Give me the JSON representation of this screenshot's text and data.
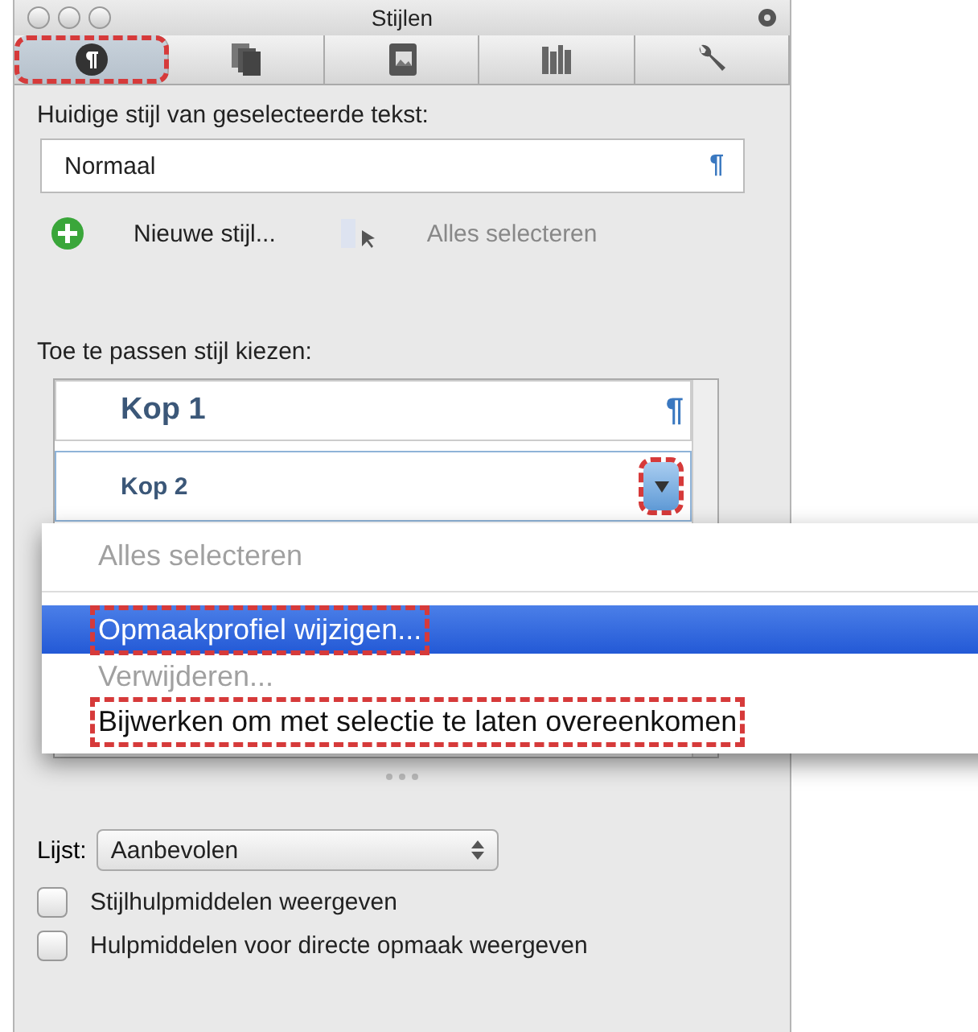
{
  "window": {
    "title": "Stijlen"
  },
  "tabs": [
    {
      "selected": true,
      "annotated": true
    },
    {
      "selected": false,
      "annotated": false
    },
    {
      "selected": false,
      "annotated": false
    },
    {
      "selected": false,
      "annotated": false
    },
    {
      "selected": false,
      "annotated": false
    }
  ],
  "current_style": {
    "label": "Huidige stijl van geselecteerde tekst:",
    "value": "Normaal",
    "mark": "¶"
  },
  "actions": [
    {
      "kind": "new",
      "label": "Nieuwe stijl...",
      "disabled": false
    },
    {
      "kind": "select_all",
      "label": "Alles selecteren",
      "disabled": true
    }
  ],
  "style_list": {
    "label": "Toe te passen stijl kiezen:",
    "items": [
      {
        "name": "Kop 1",
        "kind": "large",
        "mark": "¶",
        "expanded": false
      },
      {
        "name": "Kop 2",
        "kind": "small",
        "expanded": true,
        "annotated": true
      }
    ]
  },
  "context_menu": {
    "items": [
      {
        "label": "Alles selecteren",
        "disabled": true,
        "selected": false,
        "annotated": false
      },
      {
        "kind": "separator"
      },
      {
        "label": "Opmaakprofiel wijzigen...",
        "disabled": false,
        "selected": true,
        "annotated": true
      },
      {
        "label": "Verwijderen...",
        "disabled": true,
        "selected": false,
        "annotated": false
      },
      {
        "label": "Bijwerken om met selectie te laten overeenkomen",
        "disabled": false,
        "selected": false,
        "annotated": true
      }
    ]
  },
  "list_filter": {
    "label": "Lijst:",
    "value": "Aanbevolen"
  },
  "options": [
    {
      "label": "Stijlhulpmiddelen weergeven",
      "checked": false
    },
    {
      "label": "Hulpmiddelen voor directe opmaak weergeven",
      "checked": false
    }
  ]
}
